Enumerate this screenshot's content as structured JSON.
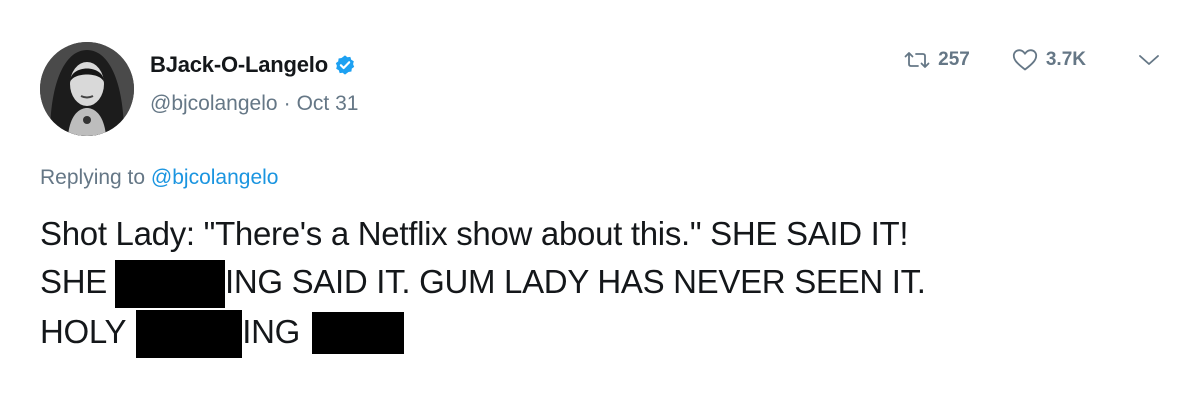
{
  "user": {
    "display_name": "BJack-O-Langelo",
    "handle": "@bjcolangelo",
    "separator": "·",
    "date": "Oct 31",
    "verified": true
  },
  "actions": {
    "retweet_count": "257",
    "like_count": "3.7K",
    "retweet_icon": "retweet-icon",
    "like_icon": "heart-icon",
    "menu_icon": "chevron-down-icon"
  },
  "reply": {
    "prefix": "Replying to",
    "to_handle": "@bjcolangelo"
  },
  "tweet": {
    "line1": "Shot Lady: \"There's a Netflix show about this.\" SHE SAID IT!",
    "line2_a": "SHE",
    "line2_b": "ING SAID IT. GUM LADY HAS NEVER SEEN IT.",
    "line3_a": "HOLY",
    "line3_b": "ING"
  },
  "colors": {
    "link": "#1b95e0",
    "verified": "#1da1f2",
    "secondary_text": "#657786",
    "primary_text": "#14171a",
    "redaction": "#000000"
  }
}
